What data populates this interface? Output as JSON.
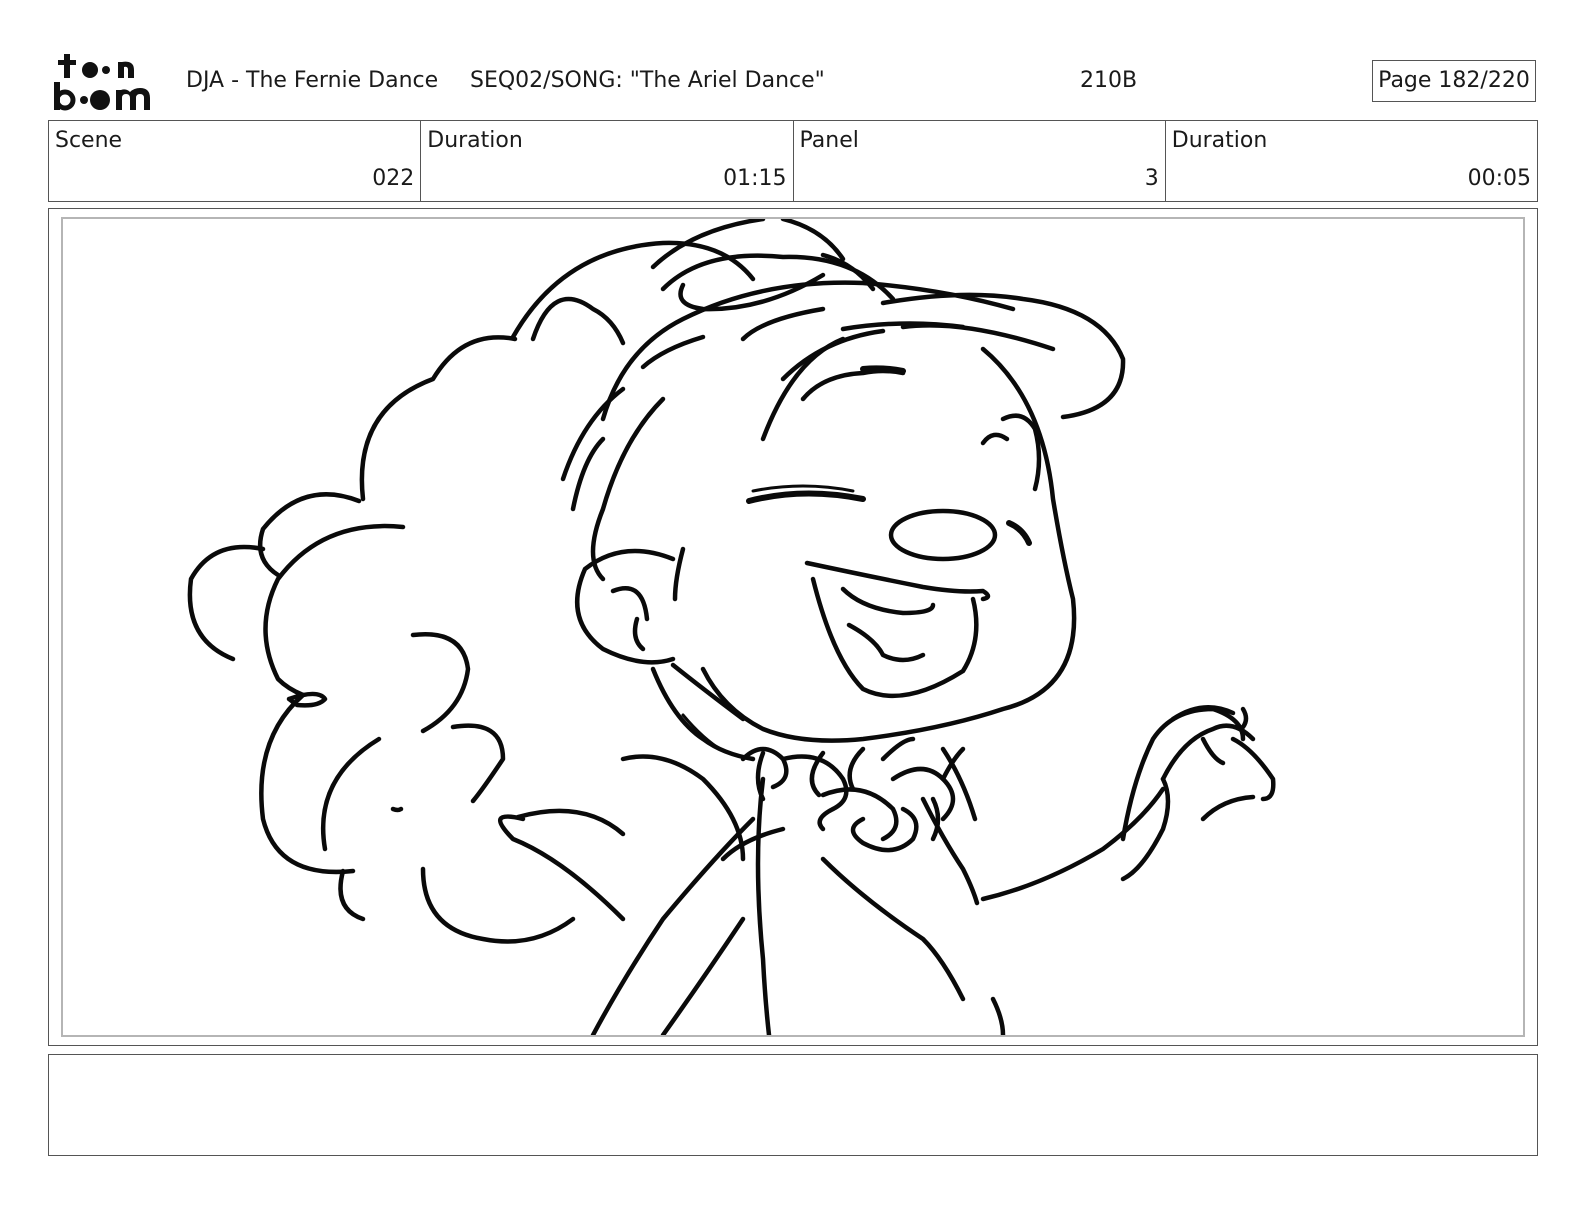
{
  "header": {
    "logo_text": "toonboom",
    "project_title": "DJA - The Fernie Dance",
    "sequence_title": "SEQ02/SONG: \"The Ariel Dance\"",
    "panel_code": "210B",
    "page_label": "Page 182/220"
  },
  "info": {
    "scene_label": "Scene",
    "scene_value": "022",
    "scene_duration_label": "Duration",
    "scene_duration_value": "01:15",
    "panel_label": "Panel",
    "panel_value": "3",
    "panel_duration_label": "Duration",
    "panel_duration_value": "00:05"
  },
  "notes": {
    "text": ""
  }
}
